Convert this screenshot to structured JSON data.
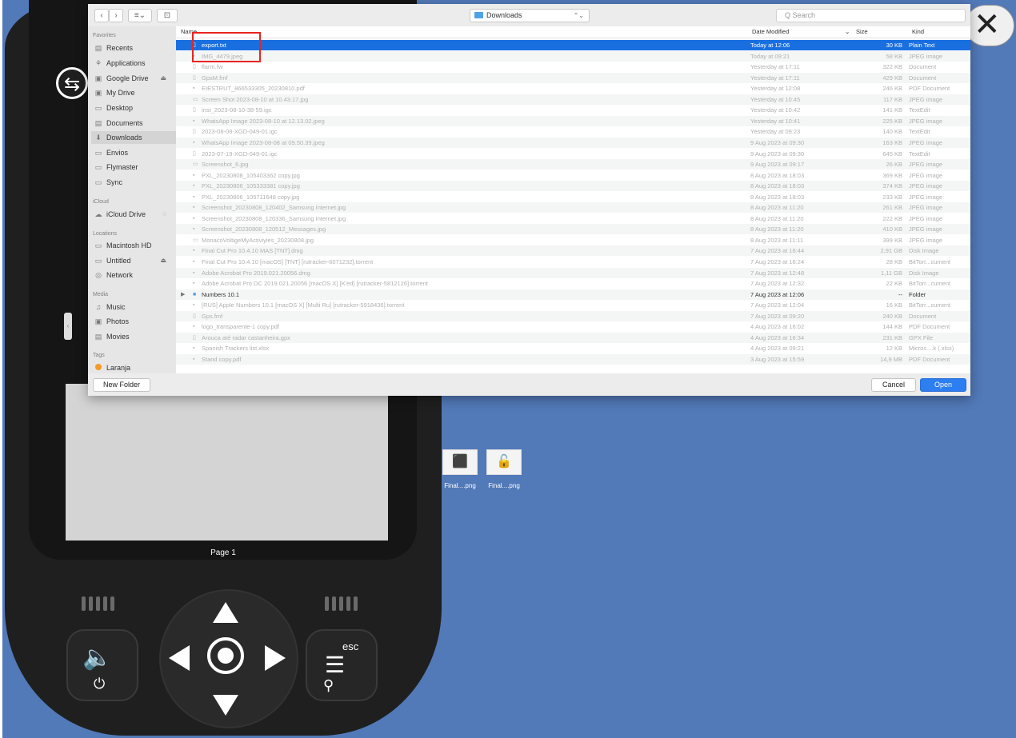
{
  "window": {
    "close_glyph": "✕"
  },
  "device": {
    "page_label": "Page 1",
    "usb_glyph": "⇆",
    "volume_glyph": "🔈",
    "power_glyph": "⏻",
    "esc_label": "esc",
    "menu_glyph": "☰",
    "search_glyph": "⚲"
  },
  "desktop": {
    "files": [
      {
        "label": "Final....png",
        "icon": "usb-device-icon",
        "glyph": "⬛"
      },
      {
        "label": "Final....png",
        "icon": "lock-device-icon",
        "glyph": "🔓"
      }
    ]
  },
  "toolbar": {
    "back_glyph": "‹",
    "forward_glyph": "›",
    "view_glyph": "≡⌄",
    "newfolder_glyph": "⊡",
    "location": "Downloads",
    "location_chevron": "⌃⌄",
    "search_placeholder": "Q  Search"
  },
  "sidebar": {
    "favorites_header": "Favorites",
    "favorites": [
      {
        "label": "Recents",
        "icon": "recents-icon",
        "glyph": "▤"
      },
      {
        "label": "Applications",
        "icon": "applications-icon",
        "glyph": "⚘"
      },
      {
        "label": "Google Drive",
        "icon": "drive-icon",
        "glyph": "▣",
        "eject": "⏏"
      },
      {
        "label": "My Drive",
        "icon": "drive-icon",
        "glyph": "▣"
      },
      {
        "label": "Desktop",
        "icon": "desktop-icon",
        "glyph": "▭"
      },
      {
        "label": "Documents",
        "icon": "documents-icon",
        "glyph": "▤"
      },
      {
        "label": "Downloads",
        "icon": "downloads-icon",
        "glyph": "⬇",
        "selected": true
      },
      {
        "label": "Envios",
        "icon": "folder-icon",
        "glyph": "▭"
      },
      {
        "label": "Flymaster",
        "icon": "folder-icon",
        "glyph": "▭"
      },
      {
        "label": "Sync",
        "icon": "folder-icon",
        "glyph": "▭"
      }
    ],
    "icloud_header": "iCloud",
    "icloud": [
      {
        "label": "iCloud Drive",
        "icon": "icloud-icon",
        "glyph": "☁",
        "extra": "◌"
      }
    ],
    "locations_header": "Locations",
    "locations": [
      {
        "label": "Macintosh HD",
        "icon": "disk-icon",
        "glyph": "▭"
      },
      {
        "label": "Untitled",
        "icon": "disk-icon",
        "glyph": "▭",
        "eject": "⏏"
      },
      {
        "label": "Network",
        "icon": "network-icon",
        "glyph": "◎"
      }
    ],
    "media_header": "Media",
    "media": [
      {
        "label": "Music",
        "icon": "music-icon",
        "glyph": "♫"
      },
      {
        "label": "Photos",
        "icon": "photos-icon",
        "glyph": "▣"
      },
      {
        "label": "Movies",
        "icon": "movies-icon",
        "glyph": "▤"
      }
    ],
    "tags_header": "Tags",
    "tags": [
      {
        "label": "Laranja",
        "color": "#f59a23"
      }
    ]
  },
  "columns": {
    "name": "Name",
    "date": "Date Modified",
    "sort_glyph": "⌄",
    "size": "Size",
    "kind": "Kind"
  },
  "files": [
    {
      "name": "export.txt",
      "date": "Today at 12:06",
      "size": "30 KB",
      "kind": "Plain Text",
      "glyph": "▯",
      "selected": true
    },
    {
      "name": "IMG_4479.jpeg",
      "date": "Today at 09:21",
      "size": "58 KB",
      "kind": "JPEG image",
      "glyph": "▪"
    },
    {
      "name": "flarm.fw",
      "date": "Yesterday at 17:11",
      "size": "322 KB",
      "kind": "Document",
      "glyph": "▯"
    },
    {
      "name": "GpsM.fmf",
      "date": "Yesterday at 17:11",
      "size": "429 KB",
      "kind": "Document",
      "glyph": "▯"
    },
    {
      "name": "EIESTRUT_866533305_20230810.pdf",
      "date": "Yesterday at 12:08",
      "size": "246 KB",
      "kind": "PDF Document",
      "glyph": "▪"
    },
    {
      "name": "Screen Shot 2023-08-10 at 10.43.17.jpg",
      "date": "Yesterday at 10:45",
      "size": "117 KB",
      "kind": "JPEG image",
      "glyph": "▭"
    },
    {
      "name": "inst_2023-08-10-38-59.igc",
      "date": "Yesterday at 10:42",
      "size": "141 KB",
      "kind": "TextEdit",
      "glyph": "▯"
    },
    {
      "name": "WhatsApp Image 2023-08-10 at 12.13.02.jpeg",
      "date": "Yesterday at 10:41",
      "size": "225 KB",
      "kind": "JPEG image",
      "glyph": "▪"
    },
    {
      "name": "2023-08-08-XGD-049-01.igc",
      "date": "Yesterday at 09:23",
      "size": "140 KB",
      "kind": "TextEdit",
      "glyph": "▯"
    },
    {
      "name": "WhatsApp Image 2023-08-08 at 09.50.39.jpeg",
      "date": "9 Aug 2023 at 09:30",
      "size": "163 KB",
      "kind": "JPEG image",
      "glyph": "▪"
    },
    {
      "name": "2023-07-19-XGD-049-01.igc",
      "date": "9 Aug 2023 at 09:30",
      "size": "645 KB",
      "kind": "TextEdit",
      "glyph": "▯"
    },
    {
      "name": "Screenshot_6.jpg",
      "date": "9 Aug 2023 at 09:17",
      "size": "26 KB",
      "kind": "JPEG image",
      "glyph": "▭"
    },
    {
      "name": "PXL_20230808_105403362 copy.jpg",
      "date": "8 Aug 2023 at 18:03",
      "size": "369 KB",
      "kind": "JPEG image",
      "glyph": "▪"
    },
    {
      "name": "PXL_20230806_105333381 copy.jpg",
      "date": "8 Aug 2023 at 18:03",
      "size": "374 KB",
      "kind": "JPEG image",
      "glyph": "▪"
    },
    {
      "name": "PXL_20230806_105711648 copy.jpg",
      "date": "8 Aug 2023 at 18:03",
      "size": "233 KB",
      "kind": "JPEG image",
      "glyph": "▪"
    },
    {
      "name": "Screenshot_20230808_120402_Samsung Internet.jpg",
      "date": "8 Aug 2023 at 11:20",
      "size": "261 KB",
      "kind": "JPEG image",
      "glyph": "▪"
    },
    {
      "name": "Screenshot_20230808_120336_Samsung Internet.jpg",
      "date": "8 Aug 2023 at 11:20",
      "size": "222 KB",
      "kind": "JPEG image",
      "glyph": "▪"
    },
    {
      "name": "Screenshot_20230808_120512_Messages.jpg",
      "date": "8 Aug 2023 at 11:20",
      "size": "410 KB",
      "kind": "JPEG image",
      "glyph": "▪"
    },
    {
      "name": "MonacoVoltigeMyActiviyies_20230808.jpg",
      "date": "8 Aug 2023 at 11:11",
      "size": "399 KB",
      "kind": "JPEG image",
      "glyph": "▭"
    },
    {
      "name": "Final Cut Pro 10.4.10 MAS [TNT].dmg",
      "date": "7 Aug 2023 at 16:44",
      "size": "2,91 GB",
      "kind": "Disk Image",
      "glyph": "▪"
    },
    {
      "name": "Final Cut Pro 10.4.10 [macOS] [TNT] [rutracker-6071232].torrent",
      "date": "7 Aug 2023 at 16:24",
      "size": "28 KB",
      "kind": "BitTorr...cument",
      "glyph": "▪"
    },
    {
      "name": "Adobe Acrobat Pro 2019.021.20056.dmg",
      "date": "7 Aug 2023 at 12:48",
      "size": "1,11 GB",
      "kind": "Disk Image",
      "glyph": "▪"
    },
    {
      "name": "Adobe Acrobat Pro DC 2019.021.20056 [macOS X] [K'ed] [rutracker-5812126].torrent",
      "date": "7 Aug 2023 at 12:32",
      "size": "22 KB",
      "kind": "BitTorr...cument",
      "glyph": "▪"
    },
    {
      "name": "Numbers 10.1",
      "date": "7 Aug 2023 at 12:06",
      "size": "--",
      "kind": "Folder",
      "glyph": "■",
      "folder": true,
      "disclosure": "▶"
    },
    {
      "name": "[RUS] Apple Numbers 10.1 [macOS X] [Multi Ru] [rutracker-5918436].torrent",
      "date": "7 Aug 2023 at 12:04",
      "size": "16 KB",
      "kind": "BitTorr...cument",
      "glyph": "▪"
    },
    {
      "name": "Gps.fmf",
      "date": "7 Aug 2023 at 09:20",
      "size": "240 KB",
      "kind": "Document",
      "glyph": "▯"
    },
    {
      "name": "logo_transparente-1 copy.pdf",
      "date": "4 Aug 2023 at 16:02",
      "size": "144 KB",
      "kind": "PDF Document",
      "glyph": "▪"
    },
    {
      "name": "Arouca até radar castanheira.gpx",
      "date": "4 Aug 2023 at 16:34",
      "size": "231 KB",
      "kind": "GPX File",
      "glyph": "▯"
    },
    {
      "name": "Spanish Trackers list.xlsx",
      "date": "4 Aug 2023 at 09:21",
      "size": "12 KB",
      "kind": "Micros....k (.xlsx)",
      "glyph": "▪"
    },
    {
      "name": "Stand copy.pdf",
      "date": "3 Aug 2023 at 15:59",
      "size": "14,9 MB",
      "kind": "PDF Document",
      "glyph": "▪"
    }
  ],
  "footer": {
    "new_folder": "New Folder",
    "cancel": "Cancel",
    "open": "Open"
  },
  "colors": {
    "desktop": "#5279b8",
    "selection": "#1a6fe0",
    "highlight_box": "#e8241f",
    "tag_orange": "#f59a23"
  }
}
